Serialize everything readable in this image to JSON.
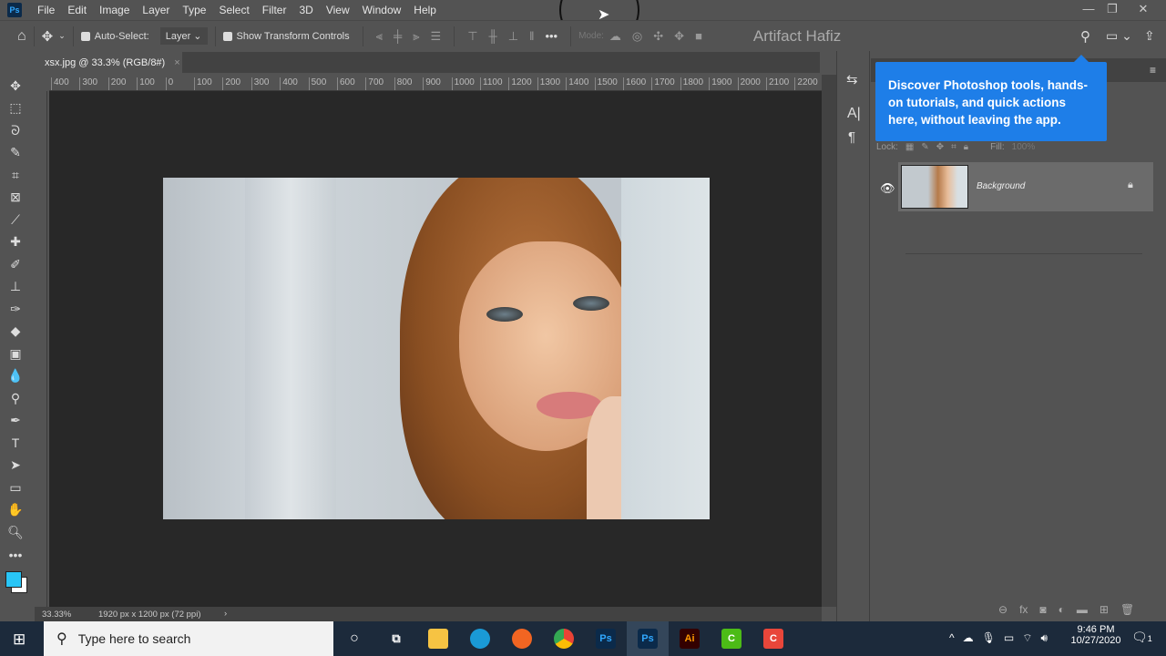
{
  "menu": {
    "items": [
      "File",
      "Edit",
      "Image",
      "Layer",
      "Type",
      "Select",
      "Filter",
      "3D",
      "View",
      "Window",
      "Help"
    ]
  },
  "options": {
    "auto_select_label": "Auto-Select:",
    "auto_select_value": "Layer",
    "show_transform_label": "Show Transform Controls",
    "mode_label": "Mode:",
    "workspace_title": "Artifact Hafiz"
  },
  "document": {
    "tab_title": "xsx.jpg @ 33.3% (RGB/8#)",
    "zoom": "33.33%",
    "dimensions": "1920 px x 1200 px (72 ppi)"
  },
  "ruler": {
    "ticks": [
      "400",
      "300",
      "200",
      "100",
      "0",
      "100",
      "200",
      "300",
      "400",
      "500",
      "600",
      "700",
      "800",
      "900",
      "1000",
      "1100",
      "1200",
      "1300",
      "1400",
      "1500",
      "1600",
      "1700",
      "1800",
      "1900",
      "2000",
      "2100",
      "2200"
    ]
  },
  "tooltip": {
    "text": "Discover Photoshop tools, hands-on tutorials, and quick actions here, without leaving the app."
  },
  "layers": {
    "lock_label": "Lock:",
    "fill_label": "Fill:",
    "fill_value": "100%",
    "items": [
      {
        "name": "Background",
        "visible": true,
        "locked": true
      }
    ]
  },
  "taskbar": {
    "search_placeholder": "Type here to search",
    "time": "9:46 PM",
    "date": "10/27/2020",
    "notification_count": "1"
  },
  "colors": {
    "foreground": "#29c5f6",
    "background": "#ffffff",
    "accent": "#1e7ee8"
  }
}
